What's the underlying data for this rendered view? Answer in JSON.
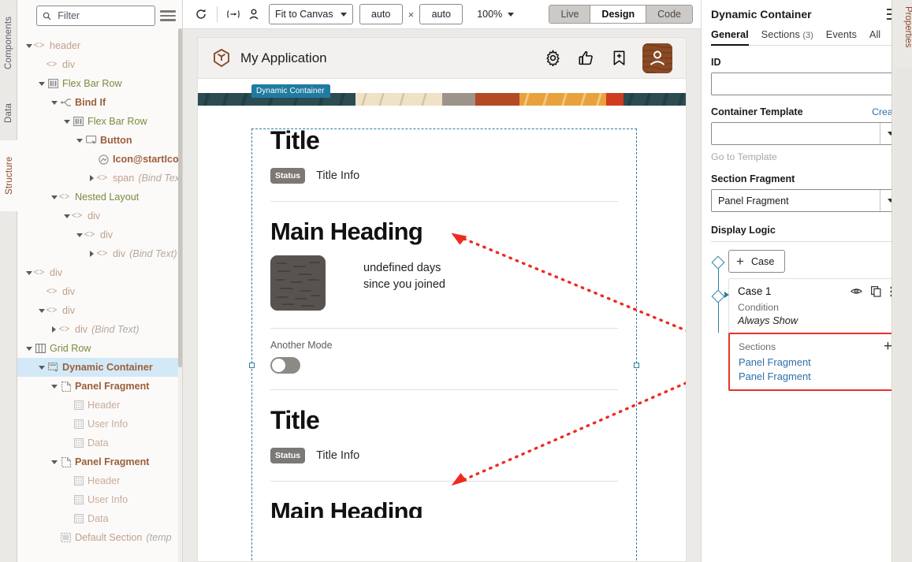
{
  "left_rail": {
    "tabs": [
      {
        "label": "Components",
        "active": false
      },
      {
        "label": "Data",
        "active": false
      },
      {
        "label": "Structure",
        "active": true
      }
    ]
  },
  "structure": {
    "filter": {
      "placeholder": "Filter",
      "value": "",
      "icon": "search-icon"
    },
    "menu_icon": "hamburger-menu-icon",
    "tree": [
      {
        "depth": 0,
        "caret": "down",
        "icon": "angle",
        "label": "header",
        "style": "tag",
        "bind": ""
      },
      {
        "depth": 1,
        "caret": "none",
        "icon": "angle",
        "label": "div",
        "style": "tag",
        "bind": ""
      },
      {
        "depth": 1,
        "caret": "down",
        "icon": "flexbar",
        "label": "Flex Bar Row",
        "style": "green",
        "bind": ""
      },
      {
        "depth": 2,
        "caret": "down",
        "icon": "bindif",
        "label": "Bind If",
        "style": "brown",
        "bind": ""
      },
      {
        "depth": 3,
        "caret": "down",
        "icon": "flexbar",
        "label": "Flex Bar Row",
        "style": "green",
        "bind": ""
      },
      {
        "depth": 4,
        "caret": "down",
        "icon": "button",
        "label": "Button",
        "style": "brown",
        "bind": ""
      },
      {
        "depth": 5,
        "caret": "none",
        "icon": "iconring",
        "label": "Icon@startIcon",
        "style": "brown",
        "bind": ""
      },
      {
        "depth": 5,
        "caret": "right",
        "icon": "angle",
        "label": "span",
        "style": "tag",
        "bind": "(Bind Text)"
      },
      {
        "depth": 2,
        "caret": "down",
        "icon": "angle",
        "label": "Nested Layout",
        "style": "green",
        "bind": ""
      },
      {
        "depth": 3,
        "caret": "down",
        "icon": "angle",
        "label": "div",
        "style": "tag",
        "bind": ""
      },
      {
        "depth": 4,
        "caret": "down",
        "icon": "angle",
        "label": "div",
        "style": "tag",
        "bind": ""
      },
      {
        "depth": 5,
        "caret": "right",
        "icon": "angle",
        "label": "div",
        "style": "tag",
        "bind": "(Bind Text)"
      },
      {
        "depth": 0,
        "caret": "down",
        "icon": "angle",
        "label": "div",
        "style": "tag",
        "bind": ""
      },
      {
        "depth": 1,
        "caret": "none",
        "icon": "angle",
        "label": "div",
        "style": "tag",
        "bind": ""
      },
      {
        "depth": 1,
        "caret": "down",
        "icon": "angle",
        "label": "div",
        "style": "tag",
        "bind": ""
      },
      {
        "depth": 2,
        "caret": "right",
        "icon": "angle",
        "label": "div",
        "style": "tag",
        "bind": "(Bind Text)"
      },
      {
        "depth": 0,
        "caret": "down",
        "icon": "gridrow",
        "label": "Grid Row",
        "style": "green",
        "bind": ""
      },
      {
        "depth": 1,
        "caret": "down",
        "icon": "dyncont",
        "label": "Dynamic Container",
        "style": "brown",
        "bind": "",
        "selected": true
      },
      {
        "depth": 2,
        "caret": "down",
        "icon": "fragment",
        "label": "Panel Fragment",
        "style": "brown",
        "bind": ""
      },
      {
        "depth": 3,
        "caret": "none",
        "icon": "section",
        "label": "Header",
        "style": "muted",
        "bind": ""
      },
      {
        "depth": 3,
        "caret": "none",
        "icon": "section",
        "label": "User Info",
        "style": "muted",
        "bind": ""
      },
      {
        "depth": 3,
        "caret": "none",
        "icon": "section",
        "label": "Data",
        "style": "muted",
        "bind": ""
      },
      {
        "depth": 2,
        "caret": "down",
        "icon": "fragment",
        "label": "Panel Fragment",
        "style": "brown",
        "bind": ""
      },
      {
        "depth": 3,
        "caret": "none",
        "icon": "section",
        "label": "Header",
        "style": "muted",
        "bind": ""
      },
      {
        "depth": 3,
        "caret": "none",
        "icon": "section",
        "label": "User Info",
        "style": "muted",
        "bind": ""
      },
      {
        "depth": 3,
        "caret": "none",
        "icon": "section",
        "label": "Data",
        "style": "muted",
        "bind": ""
      },
      {
        "depth": 2,
        "caret": "none",
        "icon": "defsec",
        "label": "Default Section",
        "style": "tag",
        "bind": "(temp"
      }
    ]
  },
  "toolbar": {
    "refresh_icon": "refresh-icon",
    "resize_icon": "horizontal-resize-icon",
    "person_icon": "person-icon",
    "fit_label": "Fit to Canvas",
    "width_value": "auto",
    "height_value": "auto",
    "dimension_separator": "×",
    "zoom_label": "100%",
    "modes": [
      {
        "label": "Live",
        "active": false
      },
      {
        "label": "Design",
        "active": true
      },
      {
        "label": "Code",
        "active": false
      }
    ]
  },
  "canvas": {
    "app_header": {
      "logo_icon": "cube-logo-icon",
      "title": "My Application",
      "icons": [
        {
          "name": "gear-icon"
        },
        {
          "name": "thumbs-up-icon"
        },
        {
          "name": "bookmark-add-icon"
        },
        {
          "name": "avatar"
        }
      ]
    },
    "overlay_label": "Dynamic Container",
    "sections": [
      {
        "title": "Title",
        "status_badge": "Status",
        "title_info": "Title Info",
        "heading": "Main Heading",
        "info_line1": "undefined days",
        "info_line2": "since you joined",
        "mode_label": "Another Mode",
        "toggle_on": false
      },
      {
        "title": "Title",
        "status_badge": "Status",
        "title_info": "Title Info"
      }
    ]
  },
  "properties": {
    "title": "Dynamic Container",
    "menu_icon": "hamburger-menu-icon",
    "tabs": [
      {
        "label": "General",
        "count": "",
        "active": true
      },
      {
        "label": "Sections",
        "count": "(3)",
        "active": false
      },
      {
        "label": "Events",
        "count": "",
        "active": false
      },
      {
        "label": "All",
        "count": "",
        "active": false
      }
    ],
    "id_label": "ID",
    "id_value": "",
    "container_template_label": "Container Template",
    "create_link": "Create",
    "container_template_value": "",
    "go_to_template": "Go to Template",
    "section_fragment_label": "Section Fragment",
    "section_fragment_value": "Panel Fragment",
    "display_logic_label": "Display Logic",
    "add_case_label": "Case",
    "case": {
      "name": "Case 1",
      "icons": [
        "eye-icon",
        "duplicate-icon",
        "more-vertical-icon"
      ],
      "condition_label": "Condition",
      "condition_value": "Always Show",
      "sections_label": "Sections",
      "add_section_icon": "plus-icon",
      "fragments": [
        "Panel Fragment",
        "Panel Fragment"
      ]
    },
    "rail_label": "Properties"
  },
  "colors": {
    "accent_blue": "#2f7fa3",
    "highlight_red": "#e8332a",
    "link_blue": "#2f6fa8",
    "tree_selected": "#d3e9f7",
    "avatar_brown": "#8a4a26"
  }
}
